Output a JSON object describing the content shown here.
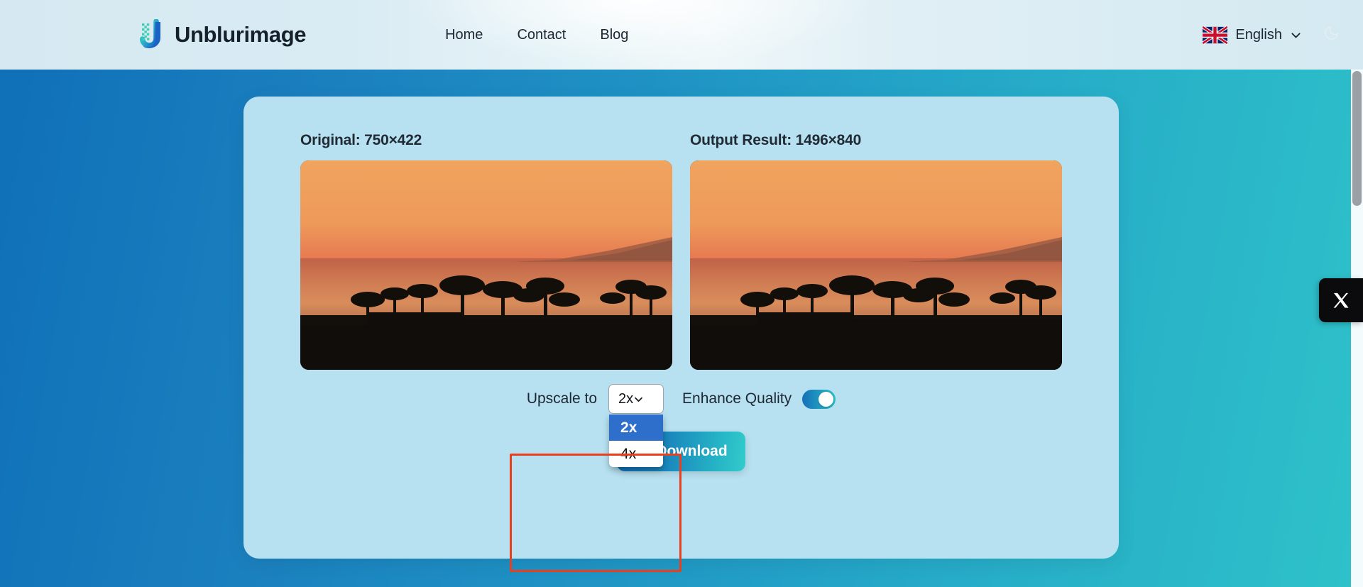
{
  "header": {
    "logo": {
      "icon": "unblurimage-u-logo-icon",
      "text": "Unblurimage"
    },
    "nav": [
      {
        "label": "Home"
      },
      {
        "label": "Contact"
      },
      {
        "label": "Blog"
      }
    ],
    "language": {
      "flag_icon": "uk-flag-icon",
      "label": "English",
      "chevron_icon": "chevron-down-icon"
    },
    "theme": {
      "icon": "moon-icon"
    }
  },
  "main": {
    "original_panel": {
      "label": "Original: 750×422",
      "image_alt": "sunset beach with palm tree silhouettes"
    },
    "output_panel": {
      "label": "Output Result: 1496×840",
      "image_alt": "sunset beach with palm tree silhouettes upscaled"
    },
    "controls": {
      "upscale_label": "Upscale to",
      "upscale_value": "2x",
      "upscale_options": [
        "2x",
        "4x"
      ],
      "upscale_selected_index": 0,
      "enhance_label": "Enhance Quality",
      "enhance_enabled": true,
      "download_label": "Download",
      "download_icon": "download-icon",
      "select_chevron_icon": "chevron-down-icon"
    }
  },
  "social": {
    "x_icon": "x-twitter-icon"
  },
  "colors": {
    "bg_gradient_start": "#0f6fb8",
    "bg_gradient_end": "#2ec2c9",
    "card_bg": "#b7e1f0",
    "accent_blue": "#1470b9",
    "accent_teal": "#2bbfc4",
    "dropdown_selected": "#2d6fcb",
    "highlight_outline": "#e8401f"
  }
}
